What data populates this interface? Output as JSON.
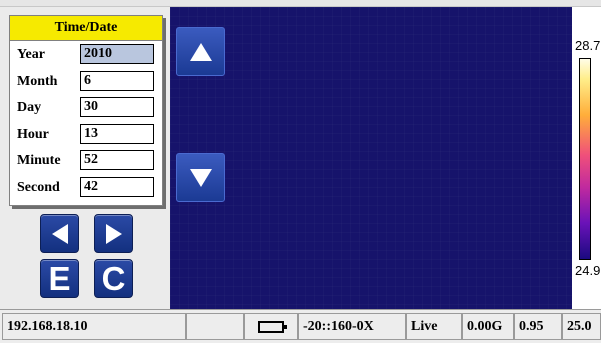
{
  "time_date_panel": {
    "title": "Time/Date",
    "fields": [
      {
        "label": "Year",
        "value": "2010",
        "selected": true
      },
      {
        "label": "Month",
        "value": "6",
        "selected": false
      },
      {
        "label": "Day",
        "value": "30",
        "selected": false
      },
      {
        "label": "Hour",
        "value": "13",
        "selected": false
      },
      {
        "label": "Minute",
        "value": "52",
        "selected": false
      },
      {
        "label": "Second",
        "value": "42",
        "selected": false
      }
    ]
  },
  "buttons": {
    "left_icon": "triangle-left-icon",
    "right_icon": "triangle-right-icon",
    "up_icon": "triangle-up-icon",
    "down_icon": "triangle-down-icon",
    "e_label": "E",
    "c_label": "C"
  },
  "scale": {
    "max": "28.7",
    "min": "24.9"
  },
  "status_bar": {
    "ip": "192.168.18.10",
    "battery_icon": "battery-icon",
    "range": "-20::160-0X",
    "mode": "Live",
    "gain": "0.00G",
    "emissivity": "0.95",
    "temp": "25.0"
  },
  "colors": {
    "thermal_background": "#16136b",
    "panel_title": "#f6ea00",
    "button_blue": "#1f3b96",
    "selected_field": "#b9c6de"
  }
}
